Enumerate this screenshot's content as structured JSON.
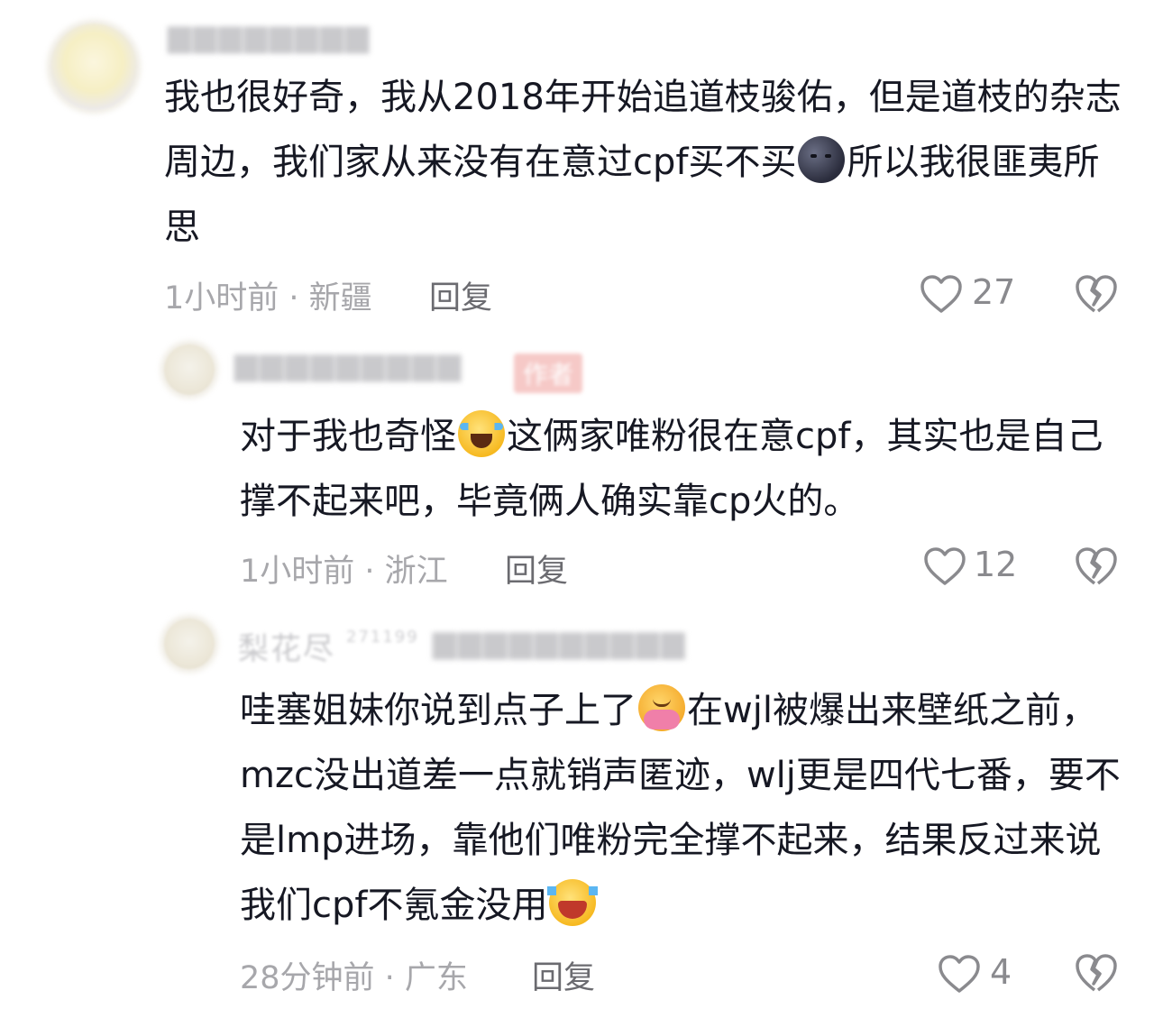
{
  "comments": [
    {
      "avatar": "lemon-avatar",
      "text_parts": [
        "我也很好奇，我从2018年开始追道枝骏佑，但是道枝的杂志周边，我们家从来没有在意过cpf买不买",
        "所以我很匪夷所思"
      ],
      "emoji": "new-moon-face-emoji",
      "time_location": "1小时前 · 新疆",
      "reply_label": "回复",
      "likes": "27"
    },
    {
      "avatar": "white-avatar",
      "author_badge": "作者",
      "text_parts": [
        "对于我也奇怪",
        "这俩家唯粉很在意cpf，其实也是自己撑不起来吧，毕竟俩人确实靠cp火的。"
      ],
      "emoji": "loudly-crying-face-emoji",
      "time_location": "1小时前 · 浙江",
      "reply_label": "回复",
      "likes": "12"
    },
    {
      "avatar": "flower-avatar",
      "username": "梨花尽",
      "user_number": "271199",
      "text_parts": [
        "哇塞姐妹你说到点子上了",
        "在wjl被爆出来壁纸之前，mzc没出道差一点就销声匿迹，wlj更是四代七番，要不是lmp进场，靠他们唯粉完全撑不起来，结果反过来说我们cpf不氪金没用",
        ""
      ],
      "emoji": "hugging-face-emoji",
      "emoji_end": "rolling-laughing-face-emoji",
      "time_location": "28分钟前 · 广东",
      "reply_label": "回复",
      "likes": "4"
    }
  ],
  "colors": {
    "text": "#161823",
    "meta": "#a7a7ab",
    "reply": "#6b6b70"
  }
}
